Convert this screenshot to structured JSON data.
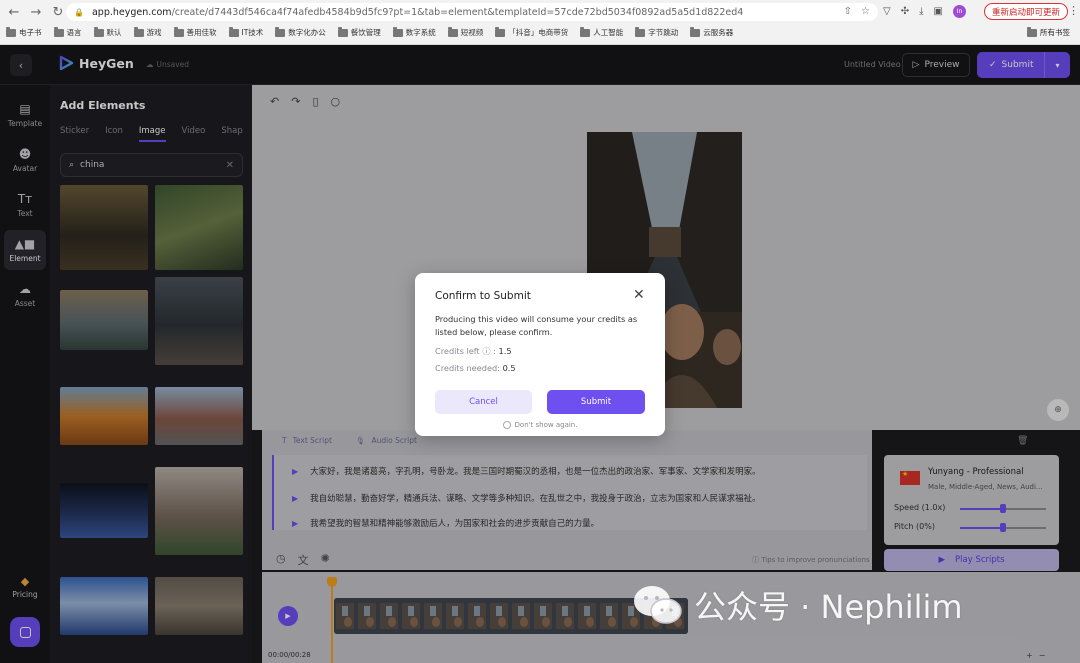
{
  "browser": {
    "url_host": "app.heygen.com",
    "url_rest": "/create/d7443df546ca4f74afedb4584b9d5fc9?pt=1&tab=element&templateId=57cde72bd5034f0892ad5a5d1d822ed4",
    "restart_label": "重新启动即可更新",
    "profile_initials": "In",
    "bookmarks": [
      "电子书",
      "语言",
      "默认",
      "游戏",
      "善用佳软",
      "IT技术",
      "数字化办公",
      "餐饮管理",
      "数字系统",
      "短视频",
      "「抖音」电商带货",
      "人工智能",
      "字节跳动",
      "云服务器"
    ],
    "bookmarks_right": "所有书签"
  },
  "header": {
    "brand": "HeyGen",
    "save_state": "Unsaved",
    "video_title": "Untitled Video",
    "preview_label": "Preview",
    "submit_label": "Submit"
  },
  "rail": {
    "items": [
      {
        "label": "Template",
        "icon": "template-icon"
      },
      {
        "label": "Avatar",
        "icon": "avatar-icon"
      },
      {
        "label": "Text",
        "icon": "text-icon"
      },
      {
        "label": "Element",
        "icon": "shapes-icon"
      },
      {
        "label": "Asset",
        "icon": "cloud-upload-icon"
      }
    ],
    "pricing_label": "Pricing"
  },
  "panel": {
    "title": "Add Elements",
    "tabs": [
      "Sticker",
      "Icon",
      "Image",
      "Video",
      "Shap"
    ],
    "active_tab": "Image",
    "search_value": "china"
  },
  "script": {
    "tabs": [
      "Text Script",
      "Audio Script"
    ],
    "lines": [
      "大家好，我是诸葛亮，字孔明，号卧龙。我是三国时期蜀汉的丞相，也是一位杰出的政治家、军事家、文学家和发明家。",
      "我自幼聪慧，勤奋好学，精通兵法、谋略、文学等多种知识。在乱世之中，我投身于政治，立志为国家和人民谋求福祉。",
      "我希望我的智慧和精神能够激励后人，为国家和社会的进步贡献自己的力量。"
    ],
    "tips": "Tips to improve pronunciations"
  },
  "voice": {
    "name": "Yunyang - Professional",
    "desc": "Male, Middle-Aged, News, Audi...",
    "speed_label": "Speed (1.0x)",
    "speed_level": 0.5,
    "pitch_label": "Pitch (0%)",
    "pitch_level": 0.5,
    "play_label": "Play Scripts"
  },
  "timeline": {
    "time": "00:00/00:28",
    "zoom_plus": "+",
    "zoom_minus": "−"
  },
  "modal": {
    "title": "Confirm to Submit",
    "body": "Producing this video will consume your credits as listed below, please confirm.",
    "credits_left_label": "Credits left",
    "credits_left_value": "1.5",
    "credits_needed_label": "Credits needed:",
    "credits_needed_value": "0.5",
    "cancel_label": "Cancel",
    "submit_label": "Submit",
    "dont_show": "Don't show again."
  },
  "watermark": {
    "text": "公众号 · Nephilim"
  },
  "colors": {
    "accent": "#6e4ff0",
    "dark_bg": "#16161a"
  }
}
